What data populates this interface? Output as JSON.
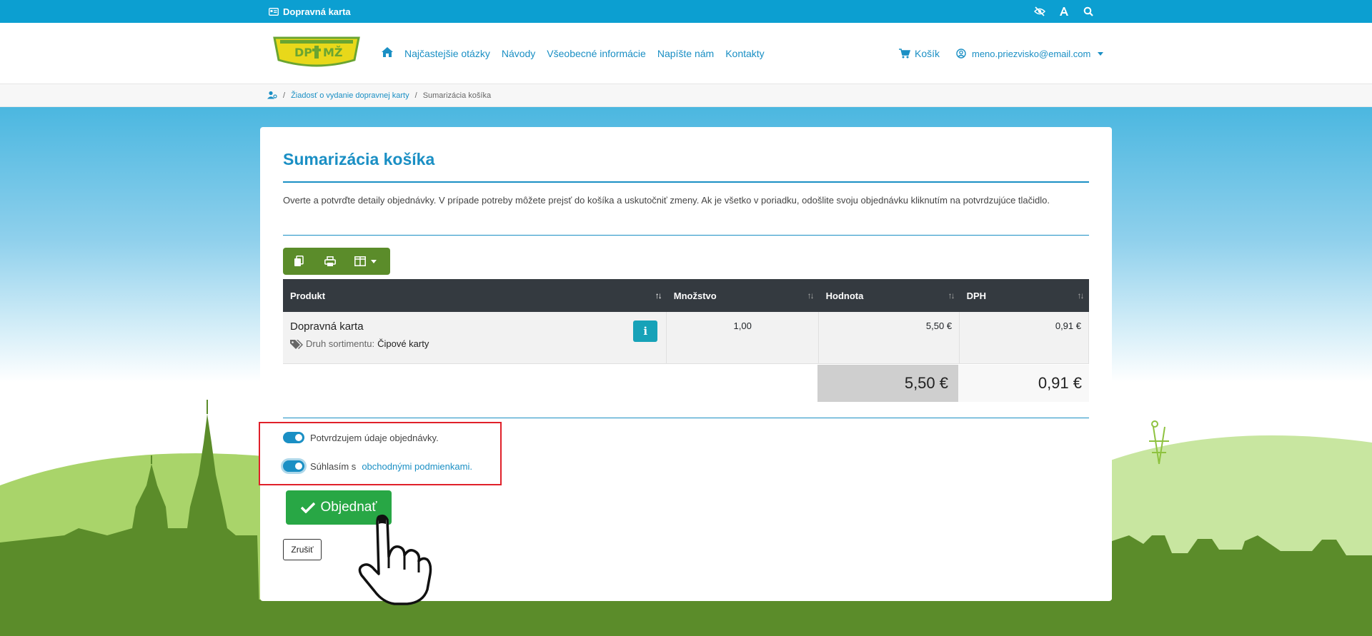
{
  "topbar": {
    "brand_label": "Dopravná karta",
    "icons": [
      "eye-slash-icon",
      "font-size-icon",
      "search-icon"
    ],
    "color": "#0c9fd1"
  },
  "header": {
    "logo_text": "DP MŽ",
    "nav": [
      {
        "label": "Najčastejšie otázky"
      },
      {
        "label": "Návody"
      },
      {
        "label": "Všeobecné informácie"
      },
      {
        "label": "Napíšte nám"
      },
      {
        "label": "Kontakty"
      }
    ],
    "cart_label": "Košík",
    "user_email": "meno.priezvisko@email.com"
  },
  "breadcrumb": {
    "items": [
      {
        "label": "Žiadosť o vydanie dopravnej karty"
      },
      {
        "label": "Sumarizácia košíka"
      }
    ]
  },
  "main": {
    "title": "Sumarizácia košíka",
    "description": "Overte a potvrďte detaily objednávky. V prípade potreby môžete prejsť do košíka a uskutočniť zmeny. Ak je všetko v poriadku, odošlite svoju objednávku kliknutím na potvrdzujúce tlačidlo.",
    "toolbar_icons": [
      "copy-icon",
      "print-icon",
      "columns-icon"
    ],
    "table": {
      "columns": [
        "Produkt",
        "Množstvo",
        "Hodnota",
        "DPH"
      ],
      "rows": [
        {
          "product": "Dopravná karta",
          "attr_label": "Druh sortimentu:",
          "attr_value": "Čipové karty",
          "quantity": "1,00",
          "value": "5,50 €",
          "vat": "0,91 €"
        }
      ],
      "total_value": "5,50 €",
      "total_vat": "0,91 €"
    },
    "confirm_label": "Potvrdzujem údaje objednávky.",
    "terms_prefix": "Súhlasím s",
    "terms_link": "obchodnými podmienkami.",
    "confirm_checked": true,
    "terms_checked": true,
    "order_button": "Objednať",
    "cancel_button": "Zrušiť"
  },
  "colors": {
    "accent": "#1a8fc4",
    "success": "#28a745",
    "toolbar": "#5b8c2a",
    "table_header": "#343a40",
    "highlight": "#e0202a"
  }
}
